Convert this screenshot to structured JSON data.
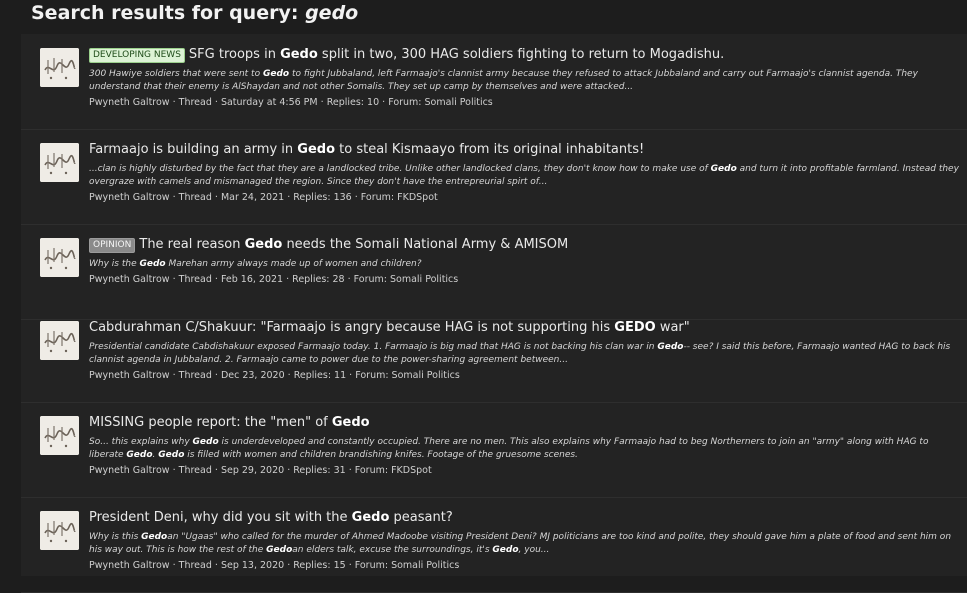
{
  "header": {
    "title_prefix": "Search results for query:",
    "query": "gedo"
  },
  "results": [
    {
      "label": "DEVELOPING NEWS",
      "title_parts": [
        [
          "SFG troops in ",
          false
        ],
        [
          "Gedo",
          true
        ],
        [
          " split in two, 300 HAG soldiers fighting to return to Mogadishu.",
          false
        ]
      ],
      "snippet_parts": [
        [
          "300 Hawiye soldiers that were sent to ",
          false
        ],
        [
          "Gedo",
          true
        ],
        [
          " to fight Jubbaland, left Farmaajo's clannist army because they refused to attack Jubbaland and carry out Farmaajo's clannist agenda. They understand that their enemy is AlShaydan and not other Somalis. They set up camp by themselves and were attacked...",
          false
        ]
      ],
      "author": "Pwyneth Galtrow",
      "type": "Thread",
      "date": "Saturday at 4:56 PM",
      "replies": "Replies: 10",
      "forum": "Forum: Somali Politics"
    },
    {
      "label": "",
      "title_parts": [
        [
          "Farmaajo is building an army in ",
          false
        ],
        [
          "Gedo",
          true
        ],
        [
          " to steal Kismaayo from its original inhabitants!",
          false
        ]
      ],
      "snippet_parts": [
        [
          "...clan is highly disturbed by the fact that they are a landlocked tribe. Unlike other landlocked clans, they don't know how to make use of ",
          false
        ],
        [
          "Gedo",
          true
        ],
        [
          " and turn it into profitable farmland. Instead they overgraze with camels and mismanaged the region. Since they don't have the entrepreurial spirt of...",
          false
        ]
      ],
      "author": "Pwyneth Galtrow",
      "type": "Thread",
      "date": "Mar 24, 2021",
      "replies": "Replies: 136",
      "forum": "Forum: FKDSpot"
    },
    {
      "label": "OPINION",
      "title_parts": [
        [
          "The real reason ",
          false
        ],
        [
          "Gedo",
          true
        ],
        [
          " needs the Somali National Army & AMISOM",
          false
        ]
      ],
      "snippet_parts": [
        [
          "Why is the ",
          false
        ],
        [
          "Gedo",
          true
        ],
        [
          " Marehan army always made up of women and children?",
          false
        ]
      ],
      "author": "Pwyneth Galtrow",
      "type": "Thread",
      "date": "Feb 16, 2021",
      "replies": "Replies: 28",
      "forum": "Forum: Somali Politics"
    },
    {
      "label": "",
      "title_parts": [
        [
          "Cabdurahman C/Shakuur: \"Farmaajo is angry because HAG is not supporting his ",
          false
        ],
        [
          "GEDO",
          true
        ],
        [
          " war\"",
          false
        ]
      ],
      "snippet_parts": [
        [
          "Presidential candidate Cabdishakuur exposed Farmaajo today. 1. Farmaajo is big mad that HAG is not backing his clan war in ",
          false
        ],
        [
          "Gedo",
          true
        ],
        [
          "-- see? I said this before, Farmaajo wanted HAG to back his clannist agenda in Jubbaland. 2. Farmaajo came to power due to the power-sharing agreement between...",
          false
        ]
      ],
      "author": "Pwyneth Galtrow",
      "type": "Thread",
      "date": "Dec 23, 2020",
      "replies": "Replies: 11",
      "forum": "Forum: Somali Politics"
    },
    {
      "label": "",
      "title_parts": [
        [
          "MISSING people report: the \"men\" of ",
          false
        ],
        [
          "Gedo",
          true
        ]
      ],
      "snippet_parts": [
        [
          "So... this explains why ",
          false
        ],
        [
          "Gedo",
          true
        ],
        [
          " is underdeveloped and constantly occupied. There are no men. This also explains why Farmaajo had to beg Northerners to join an \"army\" along with HAG to liberate ",
          false
        ],
        [
          "Gedo",
          true
        ],
        [
          ". ",
          false
        ],
        [
          "Gedo",
          true
        ],
        [
          " is filled with women and children brandishing knifes. Footage of the gruesome scenes.",
          false
        ]
      ],
      "author": "Pwyneth Galtrow",
      "type": "Thread",
      "date": "Sep 29, 2020",
      "replies": "Replies: 31",
      "forum": "Forum: FKDSpot"
    },
    {
      "label": "",
      "title_parts": [
        [
          "President Deni, why did you sit with the ",
          false
        ],
        [
          "Gedo",
          true
        ],
        [
          " peasant?",
          false
        ]
      ],
      "snippet_parts": [
        [
          "Why is this ",
          false
        ],
        [
          "Gedo",
          true
        ],
        [
          "an \"Ugaas\" who called for the murder of Ahmed Madoobe visiting President Deni? MJ politicians are too kind and polite, they should gave him a plate of food and sent him on his way out. This is how the rest of the ",
          false
        ],
        [
          "Gedo",
          true
        ],
        [
          "an elders talk, excuse the surroundings, it's ",
          false
        ],
        [
          "Gedo",
          true
        ],
        [
          ", you...",
          false
        ]
      ],
      "author": "Pwyneth Galtrow",
      "type": "Thread",
      "date": "Sep 13, 2020",
      "replies": "Replies: 15",
      "forum": "Forum: Somali Politics"
    }
  ],
  "avatar_icon": "calligraphy-avatar-icon",
  "colors": {
    "background": "#1d1d1d",
    "panel": "#232323",
    "label_green": "#ddf3d6",
    "label_grey": "#8a8a8a"
  }
}
